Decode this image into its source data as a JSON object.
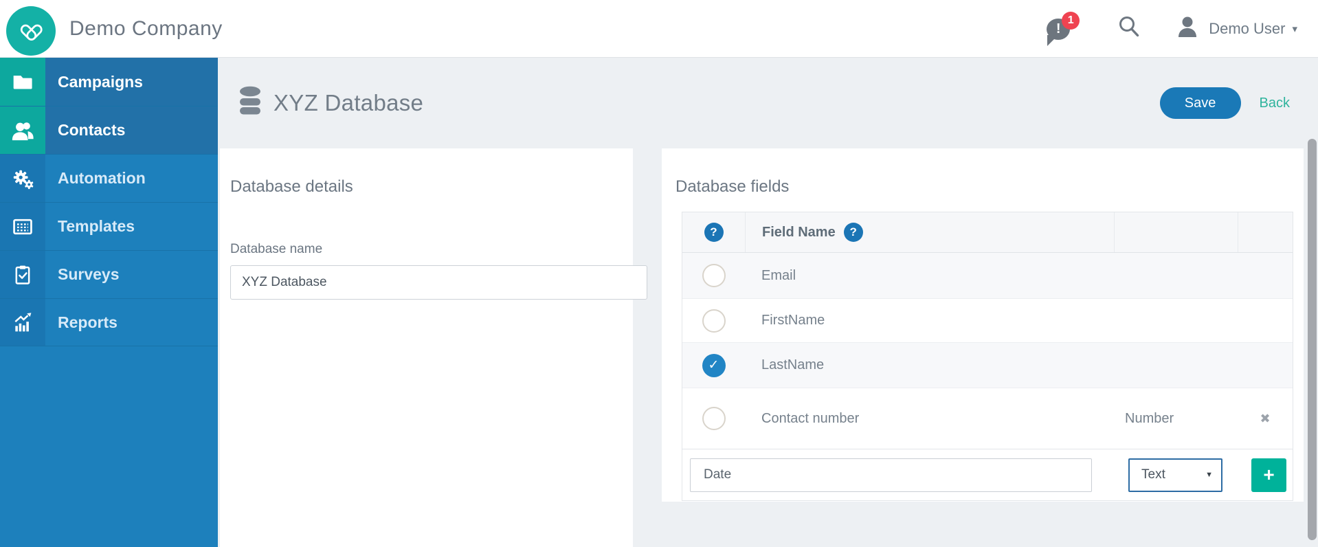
{
  "header": {
    "company": "Demo Company",
    "notification_count": "1",
    "user_name": "Demo User"
  },
  "sidebar": {
    "items": [
      {
        "label": "Campaigns",
        "icon": "folder-icon",
        "active": true
      },
      {
        "label": "Contacts",
        "icon": "contacts-icon",
        "active": true
      },
      {
        "label": "Automation",
        "icon": "gears-icon",
        "active": false
      },
      {
        "label": "Templates",
        "icon": "template-icon",
        "active": false
      },
      {
        "label": "Surveys",
        "icon": "clipboard-icon",
        "active": false
      },
      {
        "label": "Reports",
        "icon": "chart-icon",
        "active": false
      }
    ]
  },
  "page": {
    "title": "XYZ Database",
    "save_label": "Save",
    "back_label": "Back"
  },
  "details": {
    "heading": "Database details",
    "name_label": "Database name",
    "name_value": "XYZ Database"
  },
  "fields": {
    "heading": "Database fields",
    "field_name_header": "Field Name",
    "rows": [
      {
        "name": "Email",
        "checked": false,
        "type": ""
      },
      {
        "name": "FirstName",
        "checked": false,
        "type": ""
      },
      {
        "name": "LastName",
        "checked": true,
        "type": ""
      },
      {
        "name": "Contact number",
        "checked": false,
        "type": "Number",
        "deletable": true
      }
    ],
    "footer": {
      "new_field_value": "Date",
      "type_selected": "Text"
    }
  },
  "icons": {
    "help": "?",
    "check": "✓",
    "delete": "✖",
    "plus": "+",
    "exclamation": "!",
    "caret_down": "▾",
    "select_caret": "▼"
  },
  "colors": {
    "brand_teal": "#14b1a6",
    "sidebar_blue": "#1d80bc",
    "sidebar_active_teal": "#0da89e",
    "sidebar_active_label": "#2271a8",
    "primary_button_blue": "#1a79b7",
    "back_link_teal": "#2eb39c",
    "badge_red": "#ef4351",
    "checked_blue": "#2185c5",
    "add_button_teal": "#00b29a",
    "page_background": "#edf0f3"
  }
}
